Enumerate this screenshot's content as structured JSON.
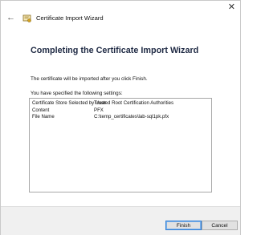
{
  "window": {
    "close_glyph": "✕",
    "back_glyph": "←",
    "title": "Certificate Import Wizard"
  },
  "main": {
    "heading": "Completing the Certificate Import Wizard",
    "intro": "The certificate will be imported after you click Finish.",
    "settings_label": "You have specified the following settings:",
    "settings": [
      {
        "key": "Certificate Store Selected by User",
        "value": "Trusted Root Certification Authorities"
      },
      {
        "key": "Content",
        "value": "PFX"
      },
      {
        "key": "File Name",
        "value": "C:\\temp_certificates\\lab-sql1pk.pfx"
      }
    ]
  },
  "footer": {
    "finish_label": "Finish",
    "cancel_label": "Cancel"
  },
  "colors": {
    "heading": "#1f2a44",
    "footer_bg": "#f0f0f0",
    "default_button_border": "#2f7fd6"
  }
}
